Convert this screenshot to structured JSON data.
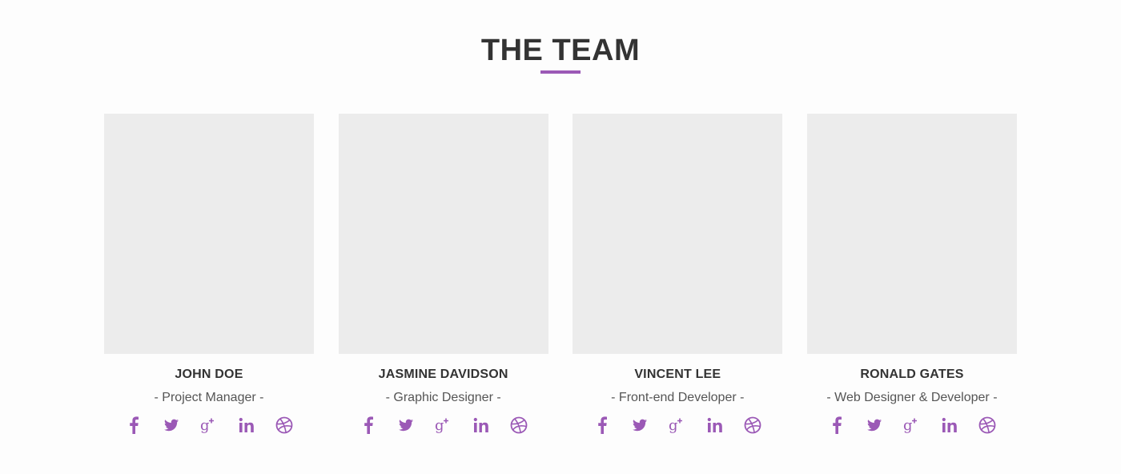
{
  "section": {
    "title": "THE TEAM",
    "accent_color": "#9b59b6"
  },
  "members": [
    {
      "name": "JOHN DOE",
      "role": "- Project Manager -",
      "social": [
        "facebook-icon",
        "twitter-icon",
        "google-plus-icon",
        "linkedin-icon",
        "dribbble-icon"
      ]
    },
    {
      "name": "JASMINE DAVIDSON",
      "role": "- Graphic Designer -",
      "social": [
        "facebook-icon",
        "twitter-icon",
        "google-plus-icon",
        "linkedin-icon",
        "dribbble-icon"
      ]
    },
    {
      "name": "VINCENT LEE",
      "role": "- Front-end Developer -",
      "social": [
        "facebook-icon",
        "twitter-icon",
        "google-plus-icon",
        "linkedin-icon",
        "dribbble-icon"
      ]
    },
    {
      "name": "RONALD GATES",
      "role": "- Web Designer & Developer -",
      "social": [
        "facebook-icon",
        "twitter-icon",
        "google-plus-icon",
        "linkedin-icon",
        "dribbble-icon"
      ]
    }
  ]
}
